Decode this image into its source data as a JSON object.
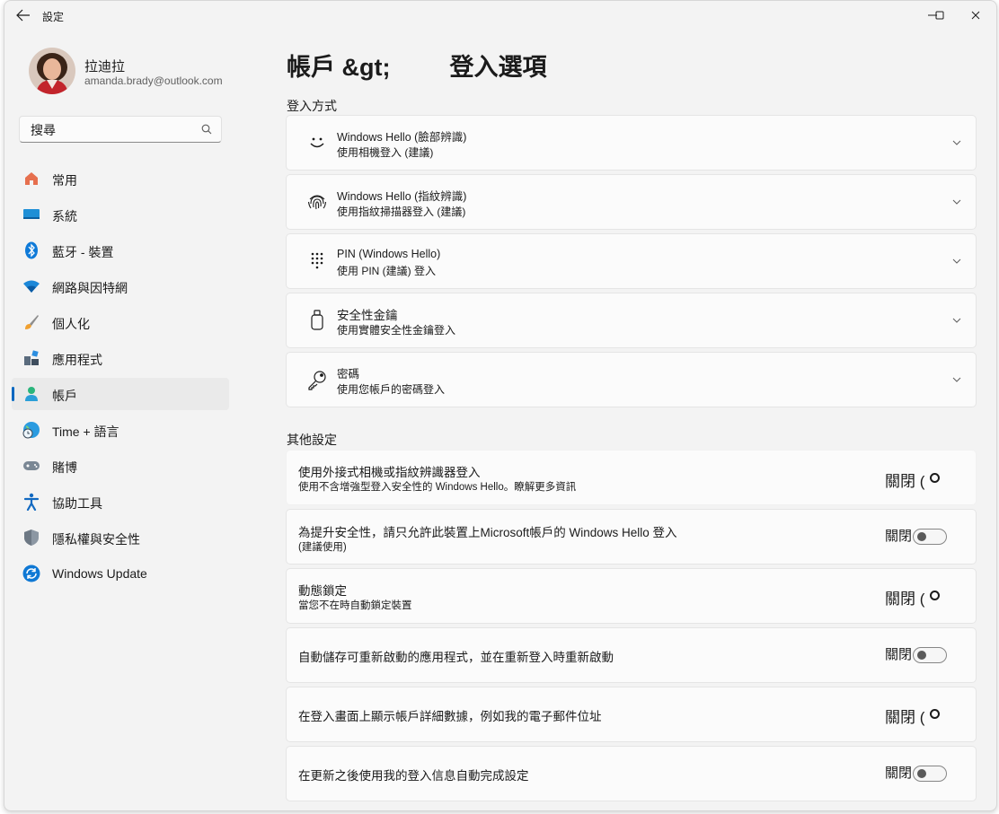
{
  "window": {
    "app_title": "設定"
  },
  "user": {
    "name": "拉迪拉",
    "email": "amanda.brady@outlook.com"
  },
  "search": {
    "placeholder": "搜尋"
  },
  "nav": [
    {
      "label": "常用",
      "icon": "home-icon"
    },
    {
      "label": "系統",
      "icon": "system-icon"
    },
    {
      "label": "藍牙 - 裝置",
      "icon": "bluetooth-icon"
    },
    {
      "label": "網路與因特網",
      "icon": "wifi-icon"
    },
    {
      "label": "個人化",
      "icon": "brush-icon"
    },
    {
      "label": "應用程式",
      "icon": "apps-icon"
    },
    {
      "label": "帳戶",
      "icon": "account-icon",
      "active": true
    },
    {
      "label": "Time + 語言",
      "icon": "time-language-icon"
    },
    {
      "label": "賭博",
      "icon": "gaming-icon"
    },
    {
      "label": "協助工具",
      "icon": "accessibility-icon"
    },
    {
      "label": "隱私權與安全性",
      "icon": "shield-icon"
    },
    {
      "label": "Windows Update",
      "icon": "update-icon"
    }
  ],
  "page": {
    "breadcrumb_parent": "帳戶 &gt;",
    "breadcrumb_current": "登入選項"
  },
  "signin_section": {
    "title": "登入方式",
    "methods": [
      {
        "title": "Windows Hello (臉部辨識)",
        "subtitle": "使用相機登入 (建議)",
        "icon": "face-icon"
      },
      {
        "title": "Windows Hello (指紋辨識)",
        "subtitle": "使用指紋掃描器登入 (建議)",
        "icon": "fingerprint-icon"
      },
      {
        "title": "PIN (Windows Hello)",
        "subtitle": "使用 PIN (建議) 登入",
        "icon": "pin-keypad-icon"
      },
      {
        "title": "安全性金鑰",
        "subtitle": "使用實體安全性金鑰登入",
        "icon": "usb-key-icon"
      },
      {
        "title": "密碼",
        "subtitle": "使用您帳戶的密碼登入",
        "icon": "key-icon"
      }
    ]
  },
  "other_section": {
    "title": "其他設定",
    "options": [
      {
        "title": "使用外接式相機或指紋辨識器登入",
        "subtitle": "使用不含增強型登入安全性的 Windows Hello。瞭解更多資訊",
        "state": "關閉 (",
        "control": "ring"
      },
      {
        "title": "為提升安全性，請只允許此裝置上Microsoft帳戶的 Windows  Hello 登入",
        "subtitle": "(建議使用)",
        "state": "關閉",
        "control": "toggle",
        "on": false
      },
      {
        "title": "動態鎖定",
        "subtitle": "當您不在時自動鎖定裝置",
        "state": "關閉 (",
        "control": "ring"
      },
      {
        "title": "自動儲存可重新啟動的應用程式，並在重新登入時重新啟動",
        "subtitle": "",
        "state": "關閉",
        "control": "toggle",
        "on": false
      },
      {
        "title": "在登入畫面上顯示帳戶詳細數據，例如我的電子郵件位址",
        "subtitle": "",
        "state": "關閉 (",
        "control": "ring"
      },
      {
        "title": "在更新之後使用我的登入信息自動完成設定",
        "subtitle": "",
        "state": "關閉",
        "control": "toggle",
        "on": false
      }
    ]
  }
}
